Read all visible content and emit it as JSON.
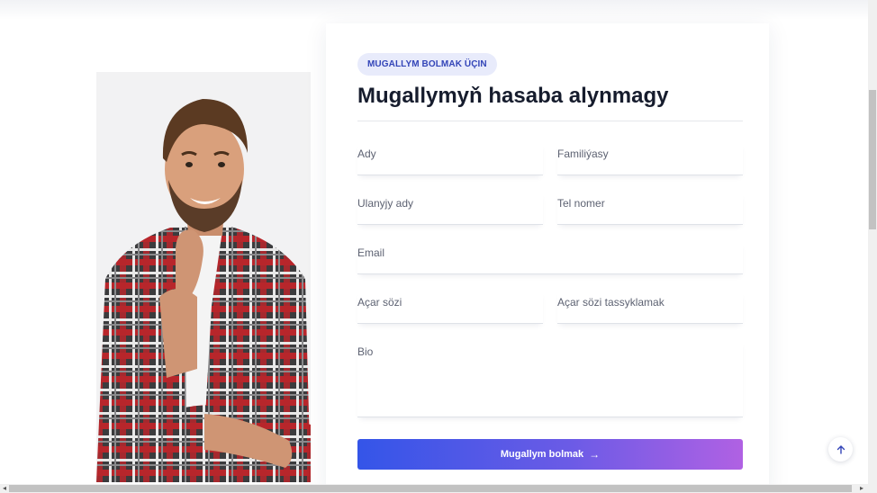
{
  "form": {
    "badge": "MUGALLYM BOLMAK ÜÇIN",
    "title": "Mugallymyň hasaba alynmagy",
    "fields": {
      "first_name": "Ady",
      "last_name": "Familiýasy",
      "username": "Ulanyjy ady",
      "phone": "Tel nomer",
      "email": "Email",
      "password": "Açar sözi",
      "confirm_password": "Açar sözi tassyklamak",
      "bio": "Bio"
    },
    "submit_label": "Mugallym bolmak",
    "submit_icon": "arrow-right-icon"
  },
  "photo": {
    "icon": "teacher-portrait"
  },
  "controls": {
    "scroll_top_icon": "arrow-up-icon"
  },
  "colors": {
    "accent_start": "#3455e8",
    "accent_end": "#b061e3",
    "badge_bg": "#e8ebfb",
    "badge_text": "#3345b8"
  }
}
